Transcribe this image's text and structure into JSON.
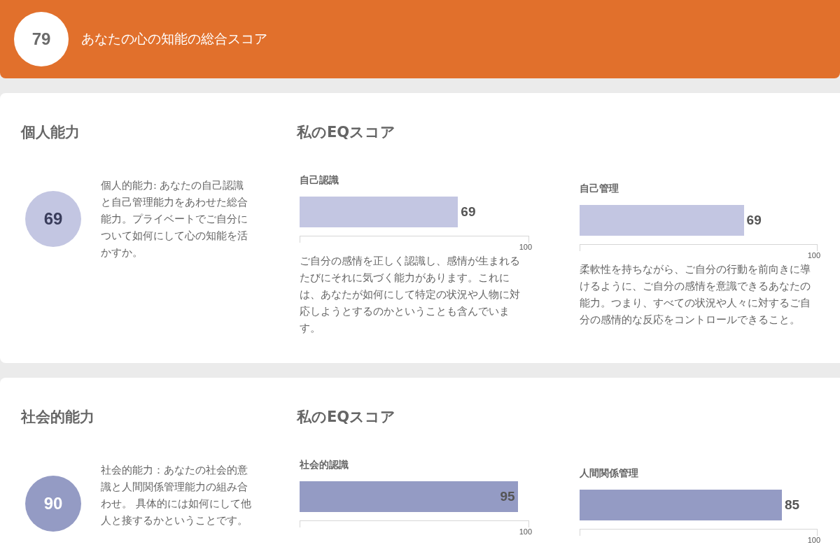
{
  "header": {
    "score": "79",
    "title": "あなたの心の知能の総合スコア"
  },
  "sections": [
    {
      "title": "個人能力",
      "score": "69",
      "color": "#c3c6e2",
      "description": "個人的能力: あなたの自己認識と自己管理能力をあわせた総合能力。プライベートでご自分について如何にして心の知能を活かすか。",
      "eq_heading": "私のEQスコア",
      "metrics": [
        {
          "label": "自己認識",
          "value": "69",
          "level": 0.69,
          "scale_max": "100",
          "description": "ご自分の感情を正しく認識し、感情が生まれるたびにそれに気づく能力があります。これには、あなたが如何にして特定の状況や人物に対応しようとするのかということも含んでいます。"
        },
        {
          "label": "自己管理",
          "value": "69",
          "level": 0.69,
          "scale_max": "100",
          "description": "柔軟性を持ちながら、ご自分の行動を前向きに導けるように、ご自分の感情を意識できるあなたの能力。つまり、すべての状況や人々に対するご自分の感情的な反応をコントロールできること。"
        }
      ]
    },
    {
      "title": "社会的能力",
      "score": "90",
      "color": "#949bc4",
      "description": "社会的能力：あなたの社会的意識と人間関係管理能力の組み合わせ。 具体的には如何にして他人と接するかということです。",
      "eq_heading": "私のEQスコア",
      "metrics": [
        {
          "label": "社会的認識",
          "value": "95",
          "level": 0.95,
          "scale_max": "100"
        },
        {
          "label": "人間関係管理",
          "value": "85",
          "level": 0.85,
          "scale_max": "100"
        }
      ]
    }
  ]
}
